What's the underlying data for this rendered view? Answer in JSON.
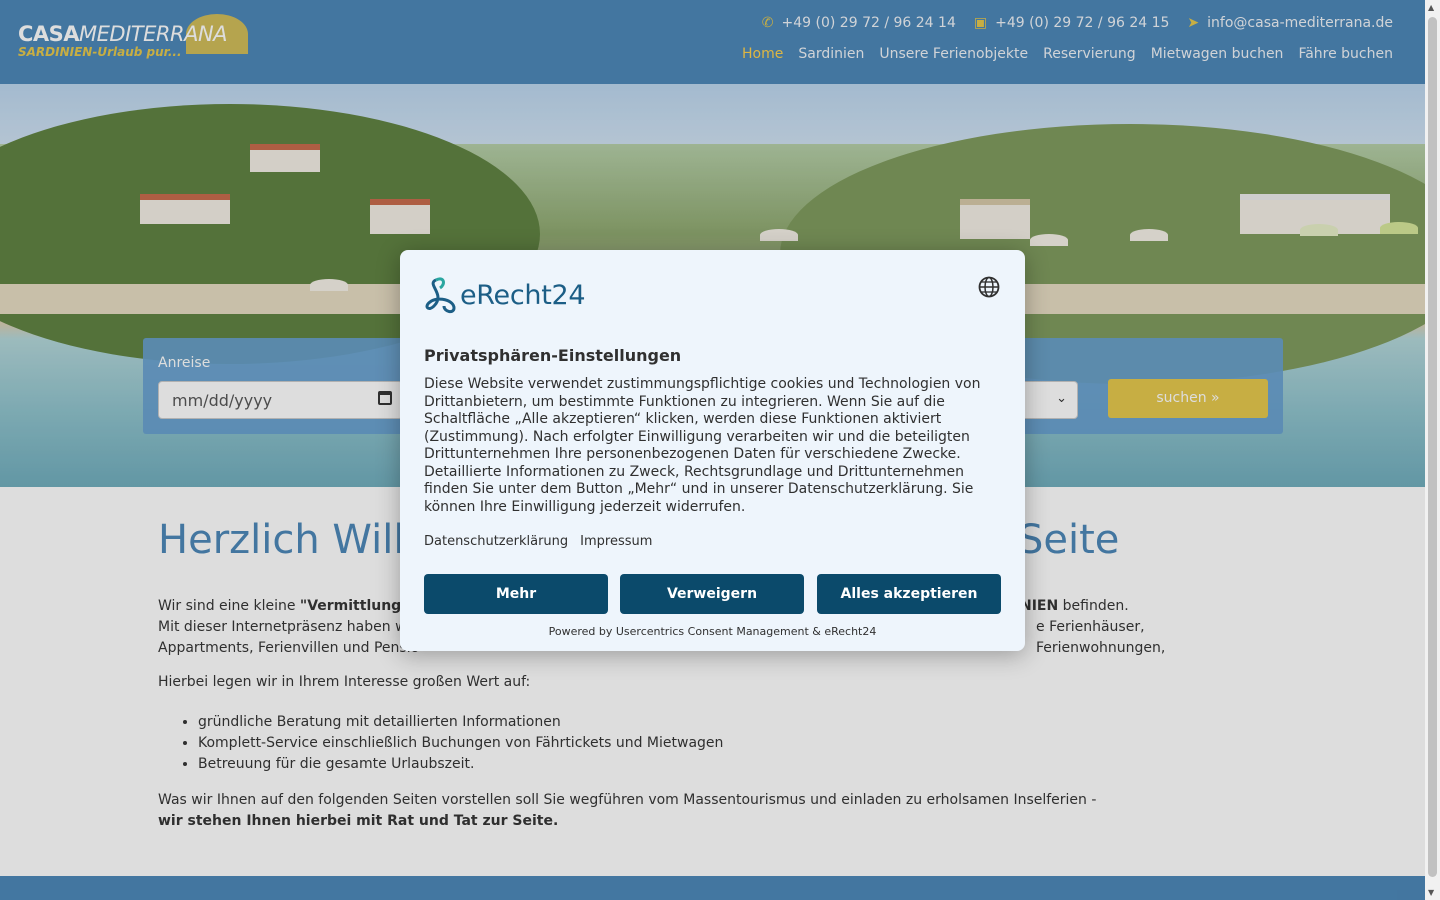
{
  "colors": {
    "accent": "#4a86b8",
    "gold": "#e6c84a",
    "modal_button": "#0b4a6b",
    "modal_bg": "#eef5fc"
  },
  "header": {
    "logo_line1_bold": "CASA",
    "logo_line1_italic": "MEDITERRANA",
    "logo_line2": "SARDINIEN-Urlaub pur...",
    "phone": "+49 (0) 29 72 / 96 24 14",
    "fax": "+49 (0) 29 72 / 96 24 15",
    "email": "info@casa-mediterrana.de",
    "nav": [
      "Home",
      "Sardinien",
      "Unsere Ferienobjekte",
      "Reservierung",
      "Mietwagen buchen",
      "Fähre buchen"
    ]
  },
  "search": {
    "label": "Anreise",
    "date_placeholder": "mm/dd/yyyy",
    "button": "suchen »"
  },
  "main": {
    "title_left": "Herzlich Willk",
    "title_right": "Seite",
    "p1_a": "Wir sind eine kleine ",
    "p1_bold": "\"Vermittlungs-Ag",
    "p1_bold_right": "NIEN",
    "p1_right": " befinden.",
    "p1_line2_left": "Mit dieser Internetpräsenz haben wir",
    "p1_line2_right": "e Ferienhäuser, Ferienwohnungen,",
    "p1_line3": "Appartments, Ferienvillen und Pensio",
    "p2": "Hierbei legen wir in Ihrem Interesse großen Wert auf:",
    "list": [
      "gründliche Beratung mit detaillierten Informationen",
      "Komplett-Service einschließlich Buchungen von Fährtickets und Mietwagen",
      "Betreuung für die gesamte Urlaubszeit."
    ],
    "p3": "Was wir Ihnen auf den folgenden Seiten vorstellen soll Sie wegführen vom Massentourismus und einladen zu erholsamen Inselferien -",
    "p3_bold": "wir stehen Ihnen hierbei mit Rat und Tat zur Seite."
  },
  "consent": {
    "brand": "eRecht24",
    "title": "Privatsphären-Einstellungen",
    "text": "Diese Website verwendet zustimmungspflichtige cookies und Technologien von Drittanbietern, um bestimmte Funktionen zu integrieren. Wenn Sie auf die Schaltfläche „Alle akzeptieren“ klicken, werden diese Funktionen aktiviert (Zustimmung). Nach erfolgter Einwilligung verarbeiten wir und die beteiligten Drittunternehmen Ihre personenbezogenen Daten für verschiedene Zwecke. Detaillierte Informationen zu Zweck, Rechtsgrundlage und Drittunternehmen finden Sie unter dem Button „Mehr“ und in unserer Datenschutzerklärung. Sie können Ihre Einwilligung jederzeit widerrufen.",
    "link_privacy": "Datenschutzerklärung",
    "link_imprint": "Impressum",
    "btn_more": "Mehr",
    "btn_deny": "Verweigern",
    "btn_accept": "Alles akzeptieren",
    "powered": "Powered by Usercentrics Consent Management & eRecht24"
  }
}
